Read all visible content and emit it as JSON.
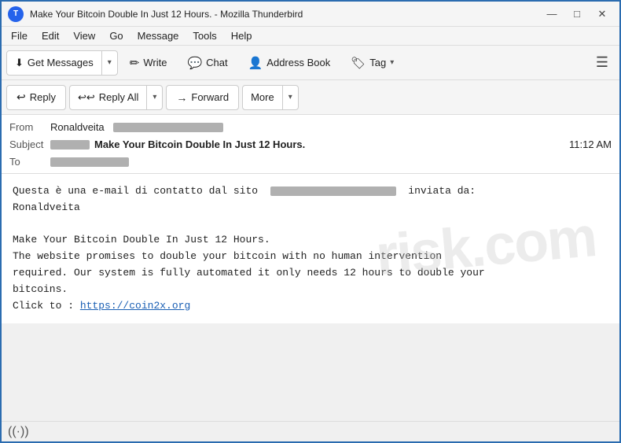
{
  "window": {
    "title": "Make Your Bitcoin Double In Just 12 Hours. - Mozilla Thunderbird",
    "icon_label": "T"
  },
  "titlebar_controls": {
    "minimize": "—",
    "maximize": "□",
    "close": "✕"
  },
  "menubar": {
    "items": [
      "File",
      "Edit",
      "View",
      "Go",
      "Message",
      "Tools",
      "Help"
    ]
  },
  "toolbar": {
    "get_messages_label": "Get Messages",
    "write_label": "Write",
    "chat_label": "Chat",
    "address_book_label": "Address Book",
    "tag_label": "Tag"
  },
  "action_toolbar": {
    "reply_label": "Reply",
    "reply_all_label": "Reply All",
    "forward_label": "Forward",
    "more_label": "More"
  },
  "email_header": {
    "from_label": "From",
    "from_value": "Ronaldveita",
    "subject_label": "Subject",
    "subject_prefix": "",
    "subject_main": "Make Your Bitcoin Double In Just 12 Hours.",
    "time": "11:12 AM",
    "to_label": "To"
  },
  "email_body": {
    "line1": "Questa è una e-mail di contatto dal sito",
    "line1_cont": "inviata da:",
    "line2": "Ronaldveita",
    "blank": "",
    "line3": "Make Your Bitcoin Double In Just 12 Hours.",
    "line4": "The website promises to double your bitcoin with no human intervention",
    "line5": "required. Our system is fully automated it only needs 12 hours to double your",
    "line6": "bitcoins.",
    "line7_prefix": "Click to : ",
    "link": "https://coin2x.org"
  },
  "statusbar": {
    "icon": "((·))"
  },
  "watermark": "risk.com"
}
